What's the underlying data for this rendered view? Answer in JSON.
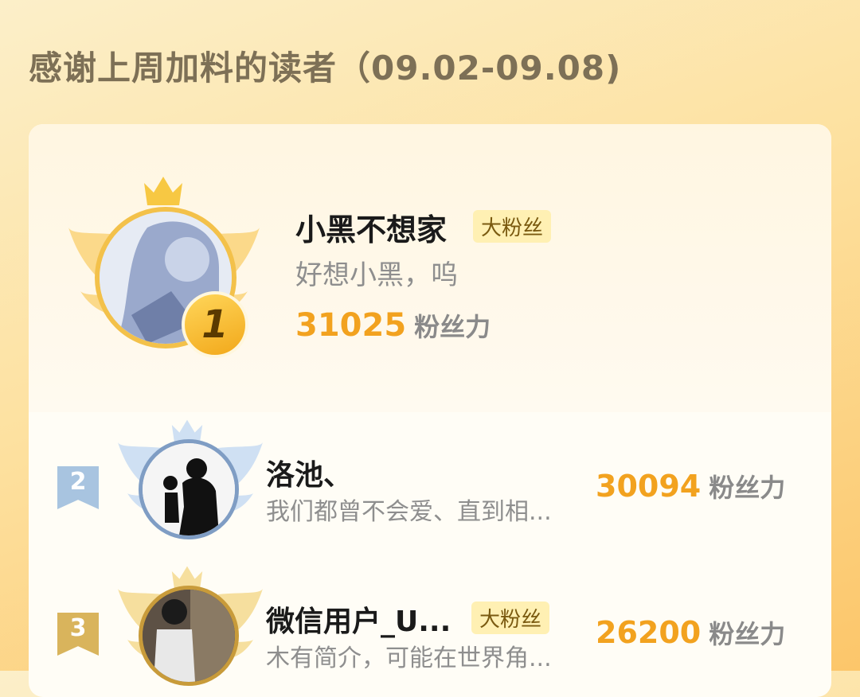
{
  "header": {
    "title": "感谢上周加料的读者（09.02-09.08)"
  },
  "leaderboard": [
    {
      "rank": "1",
      "name": "小黑不想家",
      "tag": "大粉丝",
      "desc": "好想小黑，呜",
      "score": "31025",
      "unit": "粉丝力"
    },
    {
      "rank": "2",
      "name": "洛池、",
      "tag": "",
      "desc": "我们都曾不会爱、直到相...",
      "score": "30094",
      "unit": "粉丝力"
    },
    {
      "rank": "3",
      "name": "微信用户_U...",
      "tag": "大粉丝",
      "desc": "木有简介，可能在世界角...",
      "score": "26200",
      "unit": "粉丝力"
    }
  ],
  "colors": {
    "gold": "#f2a21f",
    "silver": "#9fbedd",
    "bronze": "#d9b45c"
  }
}
